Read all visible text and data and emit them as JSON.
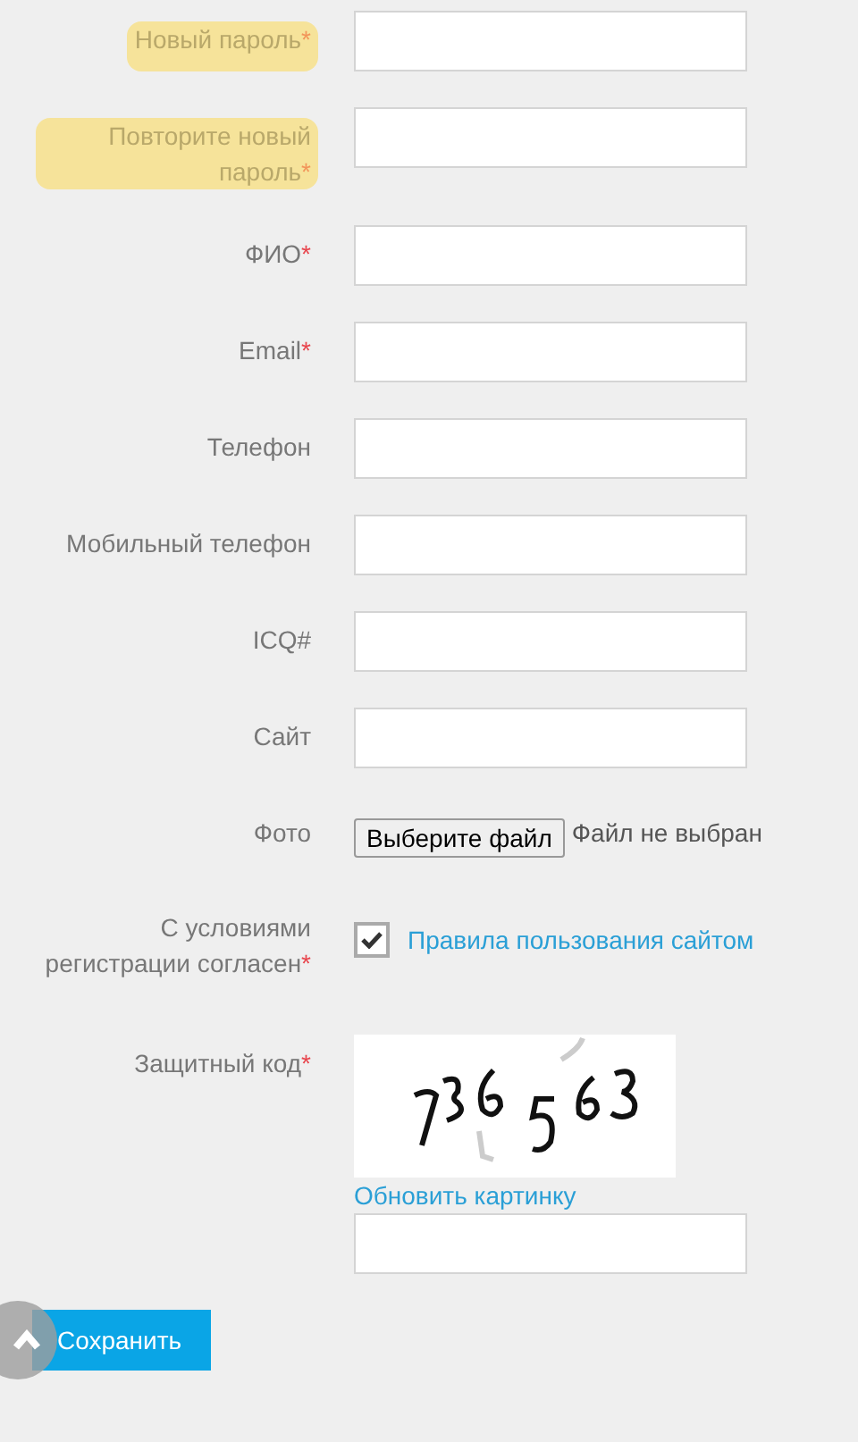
{
  "fields": [
    {
      "kind": "text",
      "label": "Новый пароль",
      "required_mark": "*",
      "highlighted": true
    },
    {
      "kind": "text",
      "label": "Повторите новый пароль",
      "required_mark": "*",
      "highlighted": true
    },
    {
      "kind": "text",
      "label": "ФИО",
      "required_mark": "*",
      "highlighted": false
    },
    {
      "kind": "text",
      "label": "Email",
      "required_mark": "*",
      "highlighted": false
    },
    {
      "kind": "text",
      "label": "Телефон",
      "highlighted": false
    },
    {
      "kind": "text",
      "label": "Мобильный телефон",
      "highlighted": false
    },
    {
      "kind": "text",
      "label": "ICQ#",
      "highlighted": false
    },
    {
      "kind": "text",
      "label": "Сайт",
      "highlighted": false
    },
    {
      "kind": "file",
      "label": "Фото",
      "highlighted": false,
      "button": "Выберите файл",
      "status": "Файл не выбран"
    },
    {
      "kind": "checkbox",
      "label": "С условиями регистрации согласен",
      "required_mark": "*",
      "highlighted": false,
      "checked": true,
      "link": "Правила пользования сайтом"
    },
    {
      "kind": "captcha",
      "label": "Защитный код",
      "required_mark": "*",
      "highlighted": false,
      "refresh": "Обновить картинку"
    }
  ],
  "save_button": "Сохранить"
}
